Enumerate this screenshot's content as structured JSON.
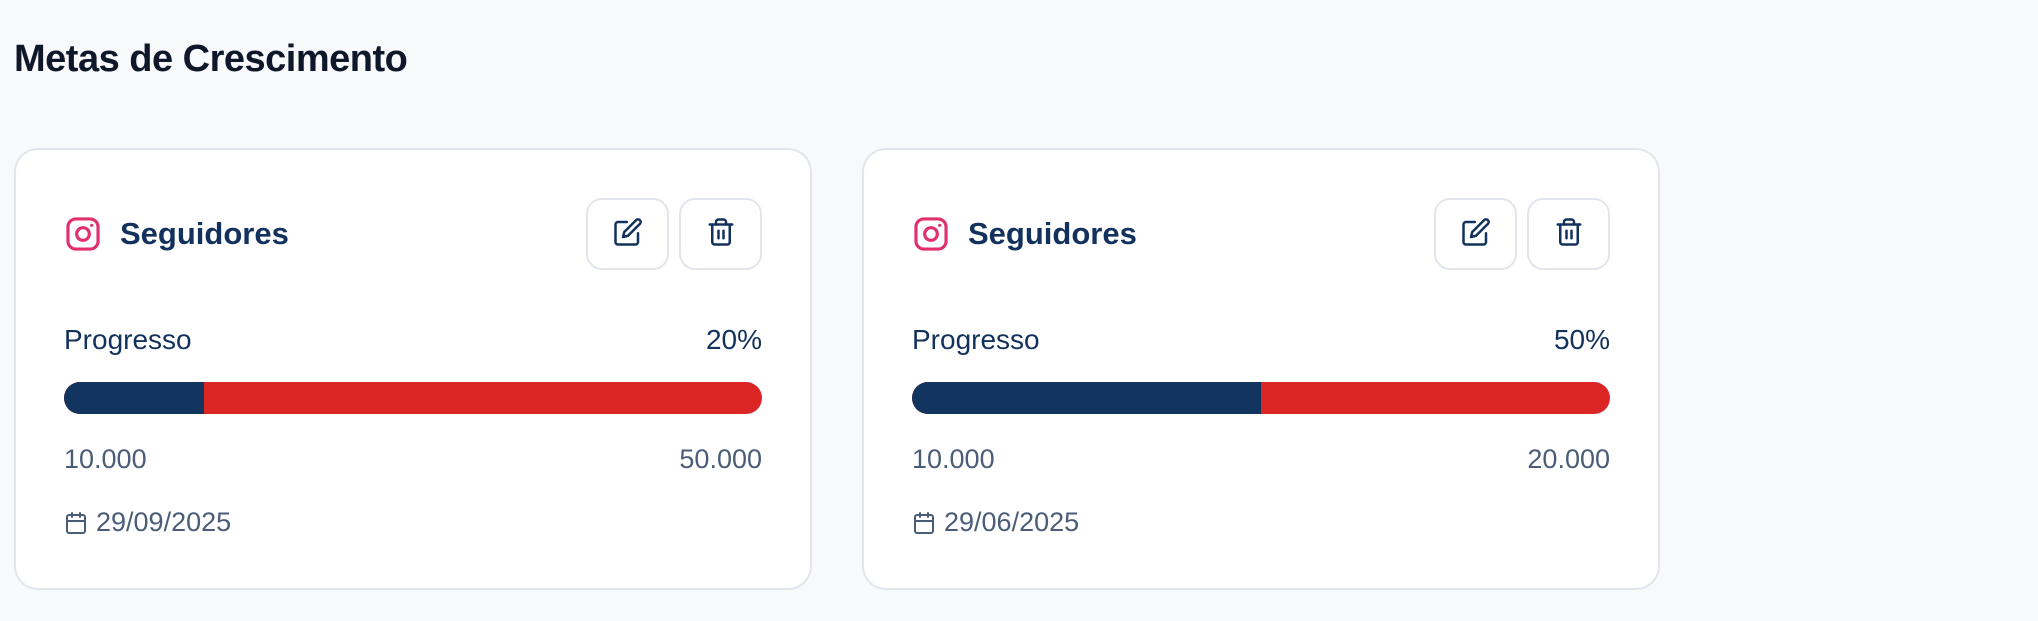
{
  "page": {
    "title": "Metas de Crescimento"
  },
  "colors": {
    "progress_fill": "#12355f",
    "progress_track": "#dc2626",
    "instagram": "#e1306c"
  },
  "goals": [
    {
      "platform_icon": "instagram-icon",
      "title": "Seguidores",
      "progress_label": "Progresso",
      "progress_percent_text": "20%",
      "progress_fraction": 0.2,
      "current": "10.000",
      "target": "50.000",
      "date_icon": "calendar-icon",
      "date": "29/09/2025"
    },
    {
      "platform_icon": "instagram-icon",
      "title": "Seguidores",
      "progress_label": "Progresso",
      "progress_percent_text": "50%",
      "progress_fraction": 0.5,
      "current": "10.000",
      "target": "20.000",
      "date_icon": "calendar-icon",
      "date": "29/06/2025"
    }
  ]
}
